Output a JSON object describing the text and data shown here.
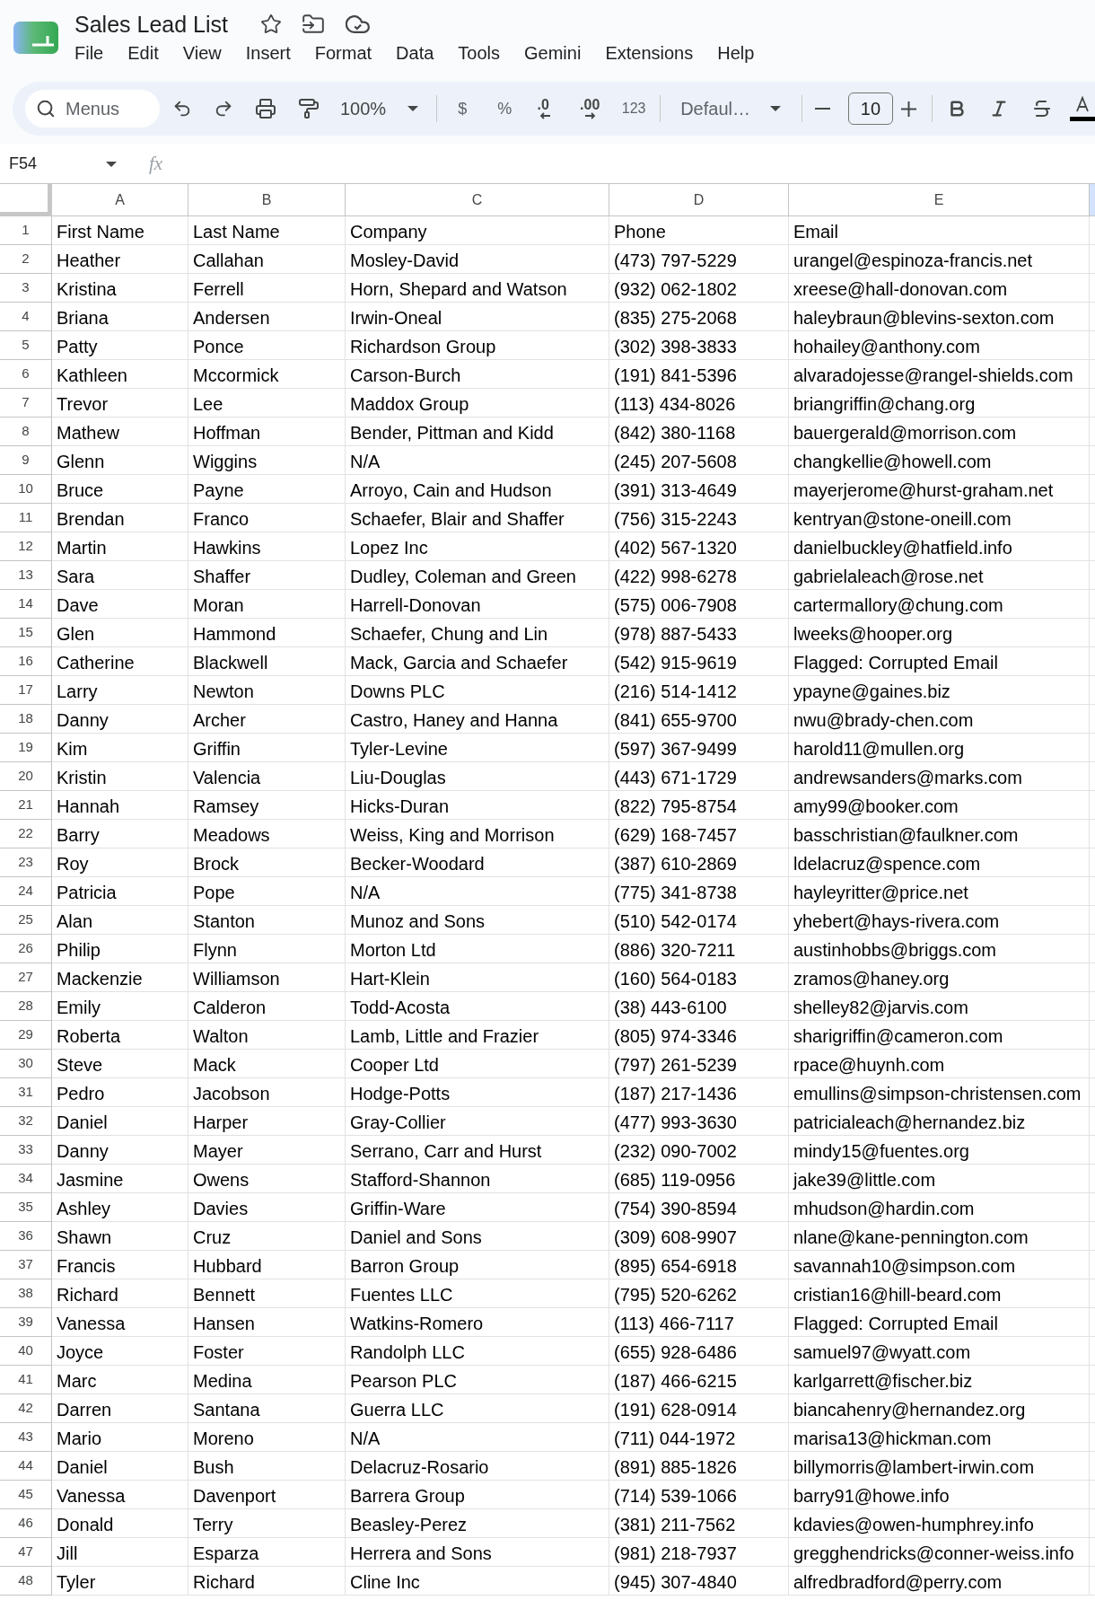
{
  "document": {
    "title": "Sales Lead List"
  },
  "menu": [
    "File",
    "Edit",
    "View",
    "Insert",
    "Format",
    "Data",
    "Tools",
    "Gemini",
    "Extensions",
    "Help"
  ],
  "toolbar": {
    "search": {
      "placeholder": "Menus"
    },
    "zoom": "100%",
    "currency": "$",
    "percent": "%",
    "decrease_decimal": ".0",
    "increase_decimal": ".00",
    "number_formats": "123",
    "font": "Defaul…",
    "font_size": "10"
  },
  "formula_bar": {
    "name_box": "F54",
    "function_label": "fx"
  },
  "columns": [
    {
      "label": "A",
      "selected": false
    },
    {
      "label": "B",
      "selected": false
    },
    {
      "label": "C",
      "selected": false
    },
    {
      "label": "D",
      "selected": false
    },
    {
      "label": "E",
      "selected": false
    }
  ],
  "column_6": {
    "selected": true
  },
  "rows": [
    {
      "number": "1",
      "cells": [
        "First Name",
        "Last Name",
        "Company",
        "Phone",
        "Email"
      ]
    },
    {
      "number": "2",
      "cells": [
        "Heather",
        "Callahan",
        "Mosley-David",
        "(473) 797-5229",
        "urangel@espinoza-francis.net"
      ]
    },
    {
      "number": "3",
      "cells": [
        "Kristina",
        "Ferrell",
        "Horn, Shepard and Watson",
        "(932) 062-1802",
        "xreese@hall-donovan.com"
      ]
    },
    {
      "number": "4",
      "cells": [
        "Briana",
        "Andersen",
        "Irwin-Oneal",
        "(835) 275-2068",
        "haleybraun@blevins-sexton.com"
      ]
    },
    {
      "number": "5",
      "cells": [
        "Patty",
        "Ponce",
        "Richardson Group",
        "(302) 398-3833",
        "hohailey@anthony.com"
      ]
    },
    {
      "number": "6",
      "cells": [
        "Kathleen",
        "Mccormick",
        "Carson-Burch",
        "(191) 841-5396",
        "alvaradojesse@rangel-shields.com"
      ]
    },
    {
      "number": "7",
      "cells": [
        "Trevor",
        "Lee",
        "Maddox Group",
        "(113) 434-8026",
        "briangriffin@chang.org"
      ]
    },
    {
      "number": "8",
      "cells": [
        "Mathew",
        "Hoffman",
        "Bender, Pittman and Kidd",
        "(842) 380-1168",
        "bauergerald@morrison.com"
      ]
    },
    {
      "number": "9",
      "cells": [
        "Glenn",
        "Wiggins",
        "N/A",
        "(245) 207-5608",
        "changkellie@howell.com"
      ]
    },
    {
      "number": "10",
      "cells": [
        "Bruce",
        "Payne",
        "Arroyo, Cain and Hudson",
        "(391) 313-4649",
        "mayerjerome@hurst-graham.net"
      ]
    },
    {
      "number": "11",
      "cells": [
        "Brendan",
        "Franco",
        "Schaefer, Blair and Shaffer",
        "(756) 315-2243",
        "kentryan@stone-oneill.com"
      ]
    },
    {
      "number": "12",
      "cells": [
        "Martin",
        "Hawkins",
        "Lopez Inc",
        "(402) 567-1320",
        "danielbuckley@hatfield.info"
      ]
    },
    {
      "number": "13",
      "cells": [
        "Sara",
        "Shaffer",
        "Dudley, Coleman and Green",
        "(422) 998-6278",
        "gabrielaleach@rose.net"
      ]
    },
    {
      "number": "14",
      "cells": [
        "Dave",
        "Moran",
        "Harrell-Donovan",
        "(575) 006-7908",
        "cartermallory@chung.com"
      ]
    },
    {
      "number": "15",
      "cells": [
        "Glen",
        "Hammond",
        "Schaefer, Chung and Lin",
        "(978) 887-5433",
        "lweeks@hooper.org"
      ]
    },
    {
      "number": "16",
      "cells": [
        "Catherine",
        "Blackwell",
        "Mack, Garcia and Schaefer",
        "(542) 915-9619",
        "Flagged: Corrupted Email"
      ]
    },
    {
      "number": "17",
      "cells": [
        "Larry",
        "Newton",
        "Downs PLC",
        "(216) 514-1412",
        "ypayne@gaines.biz"
      ]
    },
    {
      "number": "18",
      "cells": [
        "Danny",
        "Archer",
        "Castro, Haney and Hanna",
        "(841) 655-9700",
        "nwu@brady-chen.com"
      ]
    },
    {
      "number": "19",
      "cells": [
        "Kim",
        "Griffin",
        "Tyler-Levine",
        "(597) 367-9499",
        "harold11@mullen.org"
      ]
    },
    {
      "number": "20",
      "cells": [
        "Kristin",
        "Valencia",
        "Liu-Douglas",
        "(443) 671-1729",
        "andrewsanders@marks.com"
      ]
    },
    {
      "number": "21",
      "cells": [
        "Hannah",
        "Ramsey",
        "Hicks-Duran",
        "(822) 795-8754",
        "amy99@booker.com"
      ]
    },
    {
      "number": "22",
      "cells": [
        "Barry",
        "Meadows",
        "Weiss, King and Morrison",
        "(629) 168-7457",
        "basschristian@faulkner.com"
      ]
    },
    {
      "number": "23",
      "cells": [
        "Roy",
        "Brock",
        "Becker-Woodard",
        "(387) 610-2869",
        "ldelacruz@spence.com"
      ]
    },
    {
      "number": "24",
      "cells": [
        "Patricia",
        "Pope",
        "N/A",
        "(775) 341-8738",
        "hayleyritter@price.net"
      ]
    },
    {
      "number": "25",
      "cells": [
        "Alan",
        "Stanton",
        "Munoz and Sons",
        "(510) 542-0174",
        "yhebert@hays-rivera.com"
      ]
    },
    {
      "number": "26",
      "cells": [
        "Philip",
        "Flynn",
        "Morton Ltd",
        "(886) 320-7211",
        "austinhobbs@briggs.com"
      ]
    },
    {
      "number": "27",
      "cells": [
        "Mackenzie",
        "Williamson",
        "Hart-Klein",
        "(160) 564-0183",
        "zramos@haney.org"
      ]
    },
    {
      "number": "28",
      "cells": [
        "Emily",
        "Calderon",
        "Todd-Acosta",
        "(38) 443-6100",
        "shelley82@jarvis.com"
      ]
    },
    {
      "number": "29",
      "cells": [
        "Roberta",
        "Walton",
        "Lamb, Little and Frazier",
        "(805) 974-3346",
        "sharigriffin@cameron.com"
      ]
    },
    {
      "number": "30",
      "cells": [
        "Steve",
        "Mack",
        "Cooper Ltd",
        "(797) 261-5239",
        "rpace@huynh.com"
      ]
    },
    {
      "number": "31",
      "cells": [
        "Pedro",
        "Jacobson",
        "Hodge-Potts",
        "(187) 217-1436",
        "emullins@simpson-christensen.com"
      ]
    },
    {
      "number": "32",
      "cells": [
        "Daniel",
        "Harper",
        "Gray-Collier",
        "(477) 993-3630",
        "patricialeach@hernandez.biz"
      ]
    },
    {
      "number": "33",
      "cells": [
        "Danny",
        "Mayer",
        "Serrano, Carr and Hurst",
        "(232) 090-7002",
        "mindy15@fuentes.org"
      ]
    },
    {
      "number": "34",
      "cells": [
        "Jasmine",
        "Owens",
        "Stafford-Shannon",
        "(685) 119-0956",
        "jake39@little.com"
      ]
    },
    {
      "number": "35",
      "cells": [
        "Ashley",
        "Davies",
        "Griffin-Ware",
        "(754) 390-8594",
        "mhudson@hardin.com"
      ]
    },
    {
      "number": "36",
      "cells": [
        "Shawn",
        "Cruz",
        "Daniel and Sons",
        "(309) 608-9907",
        "nlane@kane-pennington.com"
      ]
    },
    {
      "number": "37",
      "cells": [
        "Francis",
        "Hubbard",
        "Barron Group",
        "(895) 654-6918",
        "savannah10@simpson.com"
      ]
    },
    {
      "number": "38",
      "cells": [
        "Richard",
        "Bennett",
        "Fuentes LLC",
        "(795) 520-6262",
        "cristian16@hill-beard.com"
      ]
    },
    {
      "number": "39",
      "cells": [
        "Vanessa",
        "Hansen",
        "Watkins-Romero",
        "(113) 466-7117",
        "Flagged: Corrupted Email"
      ]
    },
    {
      "number": "40",
      "cells": [
        "Joyce",
        "Foster",
        "Randolph LLC",
        "(655) 928-6486",
        "samuel97@wyatt.com"
      ]
    },
    {
      "number": "41",
      "cells": [
        "Marc",
        "Medina",
        "Pearson PLC",
        "(187) 466-6215",
        "karlgarrett@fischer.biz"
      ]
    },
    {
      "number": "42",
      "cells": [
        "Darren",
        "Santana",
        "Guerra LLC",
        "(191) 628-0914",
        "biancahenry@hernandez.org"
      ]
    },
    {
      "number": "43",
      "cells": [
        "Mario",
        "Moreno",
        "N/A",
        "(711) 044-1972",
        "marisa13@hickman.com"
      ]
    },
    {
      "number": "44",
      "cells": [
        "Daniel",
        "Bush",
        "Delacruz-Rosario",
        "(891) 885-1826",
        "billymorris@lambert-irwin.com"
      ]
    },
    {
      "number": "45",
      "cells": [
        "Vanessa",
        "Davenport",
        "Barrera Group",
        "(714) 539-1066",
        "barry91@howe.info"
      ]
    },
    {
      "number": "46",
      "cells": [
        "Donald",
        "Terry",
        "Beasley-Perez",
        "(381) 211-7562",
        "kdavies@owen-humphrey.info"
      ]
    },
    {
      "number": "47",
      "cells": [
        "Jill",
        "Esparza",
        "Herrera and Sons",
        "(981) 218-7937",
        "gregghendricks@conner-weiss.info"
      ]
    },
    {
      "number": "48",
      "cells": [
        "Tyler",
        "Richard",
        "Cline Inc",
        "(945) 307-4840",
        "alfredbradford@perry.com"
      ]
    }
  ]
}
